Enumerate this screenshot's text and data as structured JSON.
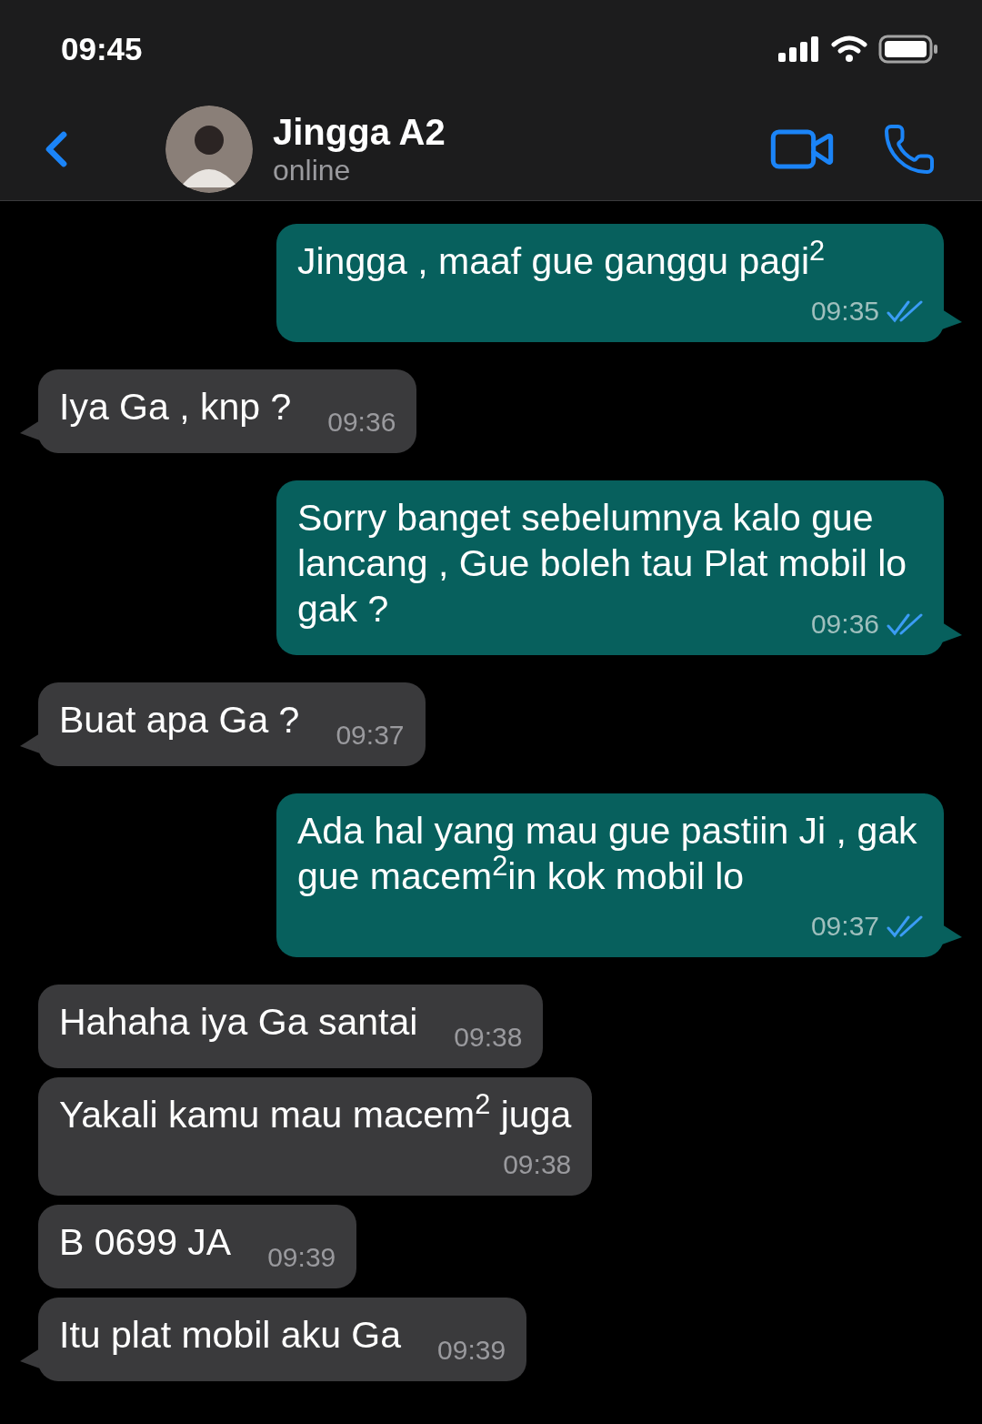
{
  "status_bar": {
    "time": "09:45"
  },
  "header": {
    "name": "Jingga A2",
    "status": "online"
  },
  "messages": [
    {
      "kind": "out",
      "text": "Jingga , maaf gue ganggu pagi$^{2}$",
      "time": "09:35",
      "read": true,
      "tail": true,
      "time_on_own_line": true
    },
    {
      "kind": "in",
      "text": "Iya Ga , knp ?",
      "time": "09:36",
      "tail": true,
      "time_on_own_line": false
    },
    {
      "kind": "out",
      "text": "Sorry banget sebelumnya kalo gue lancang , Gue boleh tau Plat mobil lo gak ?",
      "time": "09:36",
      "read": true,
      "tail": true,
      "time_on_own_line": false
    },
    {
      "kind": "in",
      "text": "Buat apa Ga ?",
      "time": "09:37",
      "tail": true,
      "time_on_own_line": false
    },
    {
      "kind": "out",
      "text": "Ada hal yang mau gue pastiin Ji , gak gue macem$^{2}$in kok mobil lo",
      "time": "09:37",
      "read": true,
      "tail": true,
      "time_on_own_line": true
    },
    {
      "kind": "in",
      "text": "Hahaha iya Ga santai",
      "time": "09:38",
      "tail": false,
      "time_on_own_line": false
    },
    {
      "kind": "in",
      "text": "Yakali kamu mau macem$^{2}$ juga",
      "time": "09:38",
      "tail": false,
      "time_on_own_line": true
    },
    {
      "kind": "in",
      "text": "B 0699 JA",
      "time": "09:39",
      "tail": false,
      "time_on_own_line": false
    },
    {
      "kind": "in",
      "text": "Itu plat mobil aku Ga",
      "time": "09:39",
      "tail": true,
      "time_on_own_line": false
    }
  ]
}
